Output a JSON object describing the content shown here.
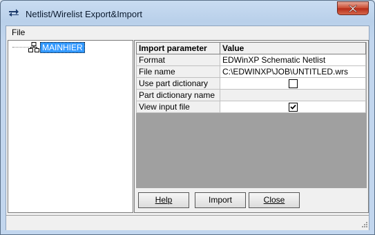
{
  "window": {
    "title": "Netlist/Wirelist Export&Import"
  },
  "menu": {
    "file_label": "File"
  },
  "tree": {
    "root_label": "MAINHIER"
  },
  "table": {
    "headers": [
      "Import parameter",
      "Value"
    ],
    "rows": [
      {
        "label": "Format",
        "value": "EDWinXP Schematic Netlist"
      },
      {
        "label": "File name",
        "value": "C:\\EDWINXP\\JOB\\UNTITLED.wrs"
      },
      {
        "label": "Use part dictionary",
        "checked": false
      },
      {
        "label": "Part dictionary name",
        "value": ""
      },
      {
        "label": "View input file",
        "checked": true
      }
    ]
  },
  "buttons": {
    "help_label": "Help",
    "import_label": "Import",
    "close_label": "Close"
  }
}
